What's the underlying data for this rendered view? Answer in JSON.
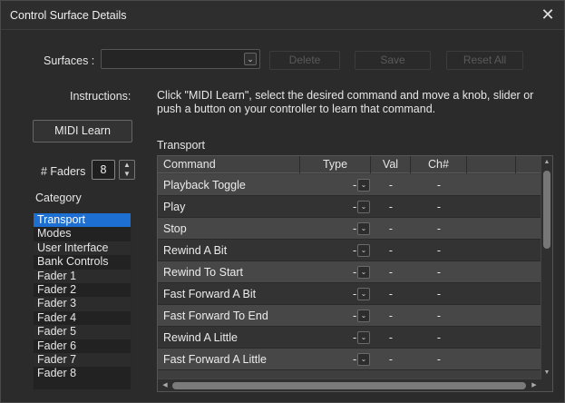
{
  "window": {
    "title": "Control Surface Details",
    "close_glyph": "✕"
  },
  "surfaces": {
    "label": "Surfaces :",
    "value": "",
    "dropdown_glyph": "⌄"
  },
  "buttons": {
    "delete": "Delete",
    "save": "Save",
    "reset_all": "Reset All",
    "midi_learn": "MIDI Learn"
  },
  "instructions": {
    "label": "Instructions:",
    "text": "Click \"MIDI Learn\", select the desired command and move a knob, slider or push a button on your controller to learn that command."
  },
  "faders": {
    "label": "# Faders",
    "value": "8",
    "up_glyph": "▲",
    "down_glyph": "▼"
  },
  "category": {
    "label": "Category",
    "items": [
      "Transport",
      "Modes",
      "User Interface",
      "Bank Controls",
      "Fader  1",
      "Fader  2",
      "Fader  3",
      "Fader  4",
      "Fader  5",
      "Fader  6",
      "Fader  7",
      "Fader  8"
    ],
    "selected": "Transport"
  },
  "table": {
    "section_label": "Transport",
    "headers": {
      "command": "Command",
      "type": "Type",
      "val": "Val",
      "ch": "Ch#"
    },
    "rows": [
      {
        "command": "Playback Toggle",
        "type": "-",
        "val": "-",
        "ch": "-"
      },
      {
        "command": "Play",
        "type": "-",
        "val": "-",
        "ch": "-"
      },
      {
        "command": "Stop",
        "type": "-",
        "val": "-",
        "ch": "-"
      },
      {
        "command": "Rewind A Bit",
        "type": "-",
        "val": "-",
        "ch": "-"
      },
      {
        "command": "Rewind To Start",
        "type": "-",
        "val": "-",
        "ch": "-"
      },
      {
        "command": "Fast Forward A Bit",
        "type": "-",
        "val": "-",
        "ch": "-"
      },
      {
        "command": "Fast Forward To End",
        "type": "-",
        "val": "-",
        "ch": "-"
      },
      {
        "command": "Rewind A Little",
        "type": "-",
        "val": "-",
        "ch": "-"
      },
      {
        "command": "Fast Forward A Little",
        "type": "-",
        "val": "-",
        "ch": "-"
      }
    ]
  },
  "icons": {
    "type_dropdown": "chevron-down-icon",
    "close": "close-icon"
  },
  "colors": {
    "selection": "#1d6fd1",
    "background": "#2b2b2b"
  }
}
